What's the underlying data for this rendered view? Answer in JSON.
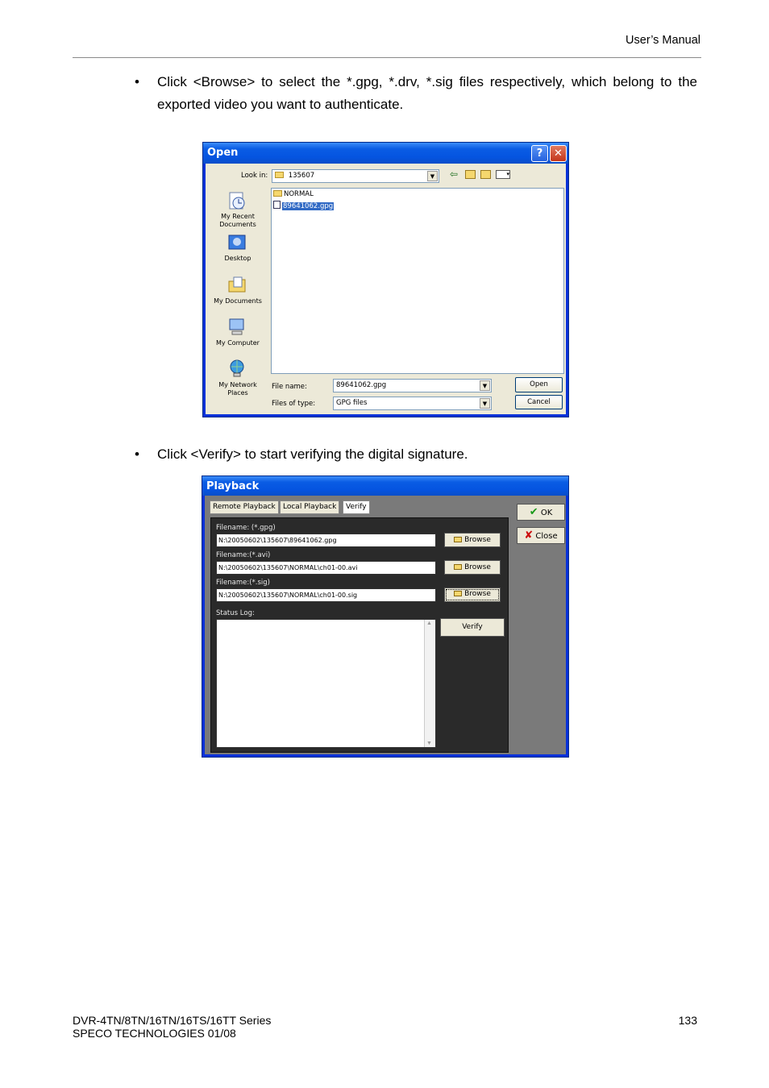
{
  "header": {
    "title": "User’s Manual"
  },
  "bullets": [
    {
      "symbol": "•",
      "text": "Click <Browse> to select the *.gpg, *.drv, *.sig files respectively, which belong to the exported video you want to authenticate."
    },
    {
      "symbol": "•",
      "text": "Click <Verify> to start verifying the digital signature."
    }
  ],
  "open_dialog": {
    "title": "Open",
    "help_glyph": "?",
    "close_glyph": "✕",
    "look_in_label": "Look in:",
    "look_in_value": "135607",
    "places": [
      "My Recent Documents",
      "Desktop",
      "My Documents",
      "My Computer",
      "My Network Places"
    ],
    "files": [
      "NORMAL",
      "89641062.gpg"
    ],
    "file_name_label": "File name:",
    "file_name_value": "89641062.gpg",
    "file_type_label": "Files of type:",
    "file_type_value": "GPG files",
    "open_button": "Open",
    "cancel_button": "Cancel",
    "icons": [
      "back-icon",
      "up-folder-icon",
      "new-folder-icon",
      "view-menu-icon"
    ]
  },
  "playback_dialog": {
    "title": "Playback",
    "tabs": [
      "Remote Playback",
      "Local Playback",
      "Verify"
    ],
    "active_tab": "Verify",
    "fields": [
      {
        "label": "Filename: (*.gpg)",
        "value": "N:\\20050602\\135607\\89641062.gpg",
        "button": "Browse"
      },
      {
        "label": "Filename:(*.avi)",
        "value": "N:\\20050602\\135607\\NORMAL\\ch01-00.avi",
        "button": "Browse"
      },
      {
        "label": "Filename:(*.sig)",
        "value": "N:\\20050602\\135607\\NORMAL\\ch01-00.sig",
        "button": "Browse"
      }
    ],
    "status_log_label": "Status Log:",
    "verify_button": "Verify",
    "ok_button": "OK",
    "close_button": "Close",
    "ok_color": "#1a9a1a",
    "close_color": "#cc1111"
  },
  "footer": {
    "model": "DVR-4TN/8TN/16TN/16TS/16TT Series",
    "company": "SPECO TECHNOLOGIES 01/08",
    "page_number": "133"
  }
}
